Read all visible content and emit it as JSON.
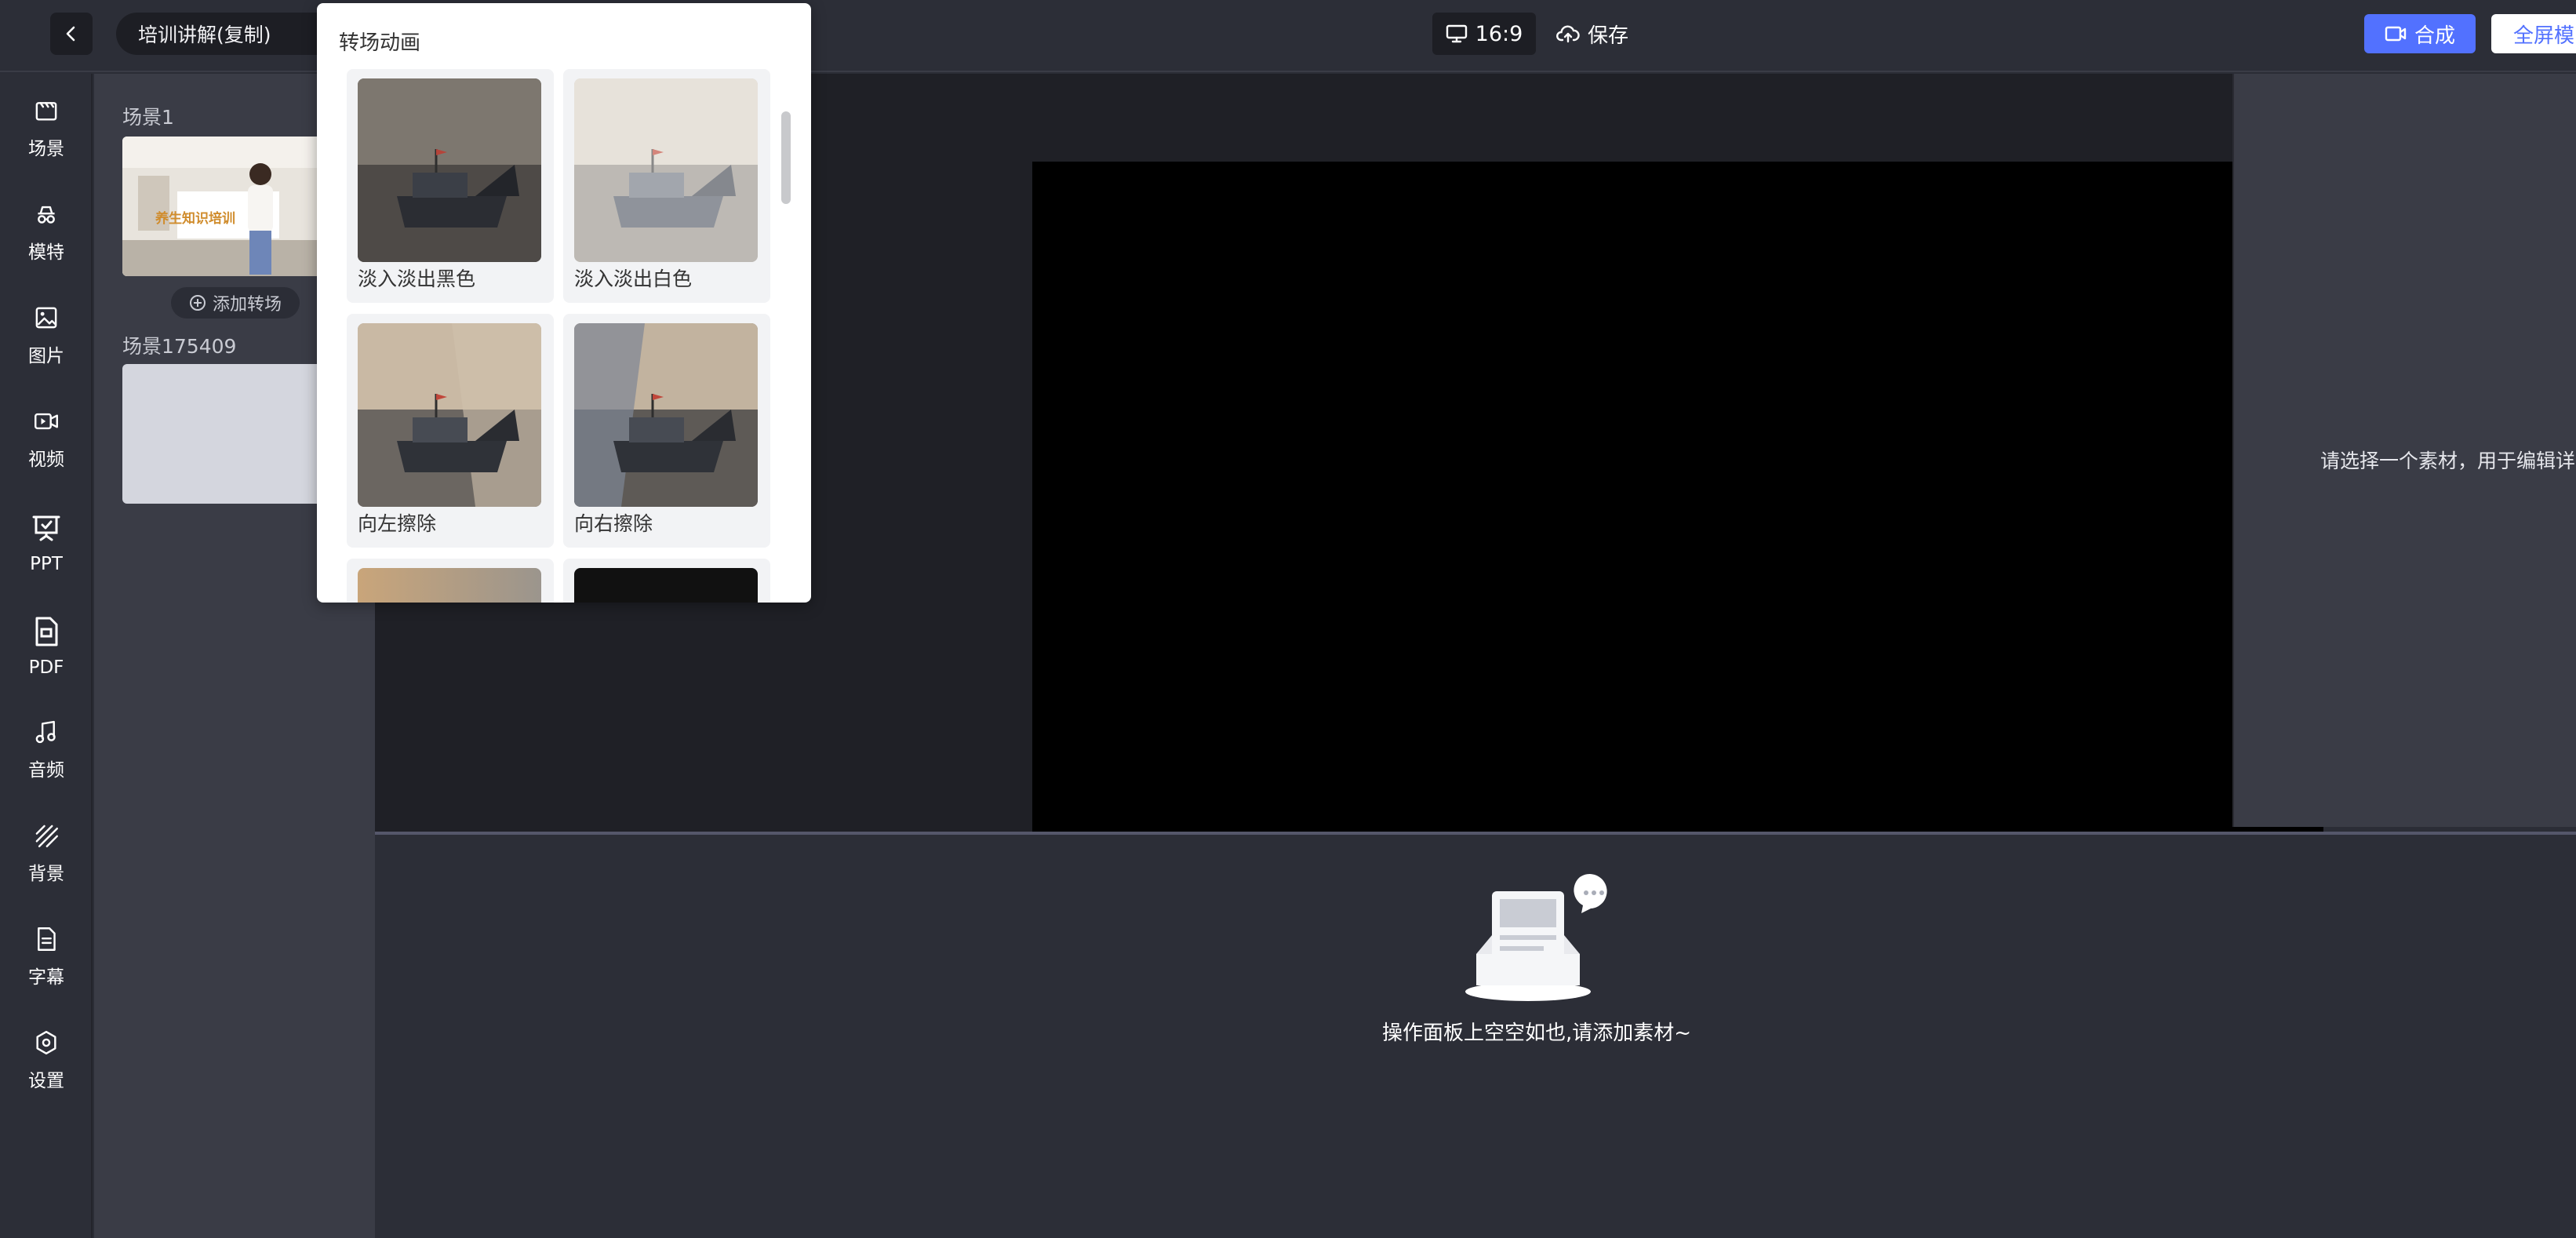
{
  "topbar": {
    "project_title": "培训讲解(复制)",
    "aspect_ratio": "16:9",
    "save_label": "保存",
    "compose_label": "合成",
    "fullscreen_label": "全屏模"
  },
  "sidebar": {
    "items": [
      {
        "label": "场景",
        "icon": "scene-icon"
      },
      {
        "label": "模特",
        "icon": "model-icon"
      },
      {
        "label": "图片",
        "icon": "image-icon"
      },
      {
        "label": "视频",
        "icon": "video-icon"
      },
      {
        "label": "PPT",
        "icon": "ppt-icon"
      },
      {
        "label": "PDF",
        "icon": "pdf-icon"
      },
      {
        "label": "音频",
        "icon": "music-icon"
      },
      {
        "label": "背景",
        "icon": "background-icon"
      },
      {
        "label": "字幕",
        "icon": "subtitle-icon"
      },
      {
        "label": "设置",
        "icon": "settings-icon"
      }
    ]
  },
  "scenes": {
    "items": [
      {
        "name": "场景1",
        "thumbnail_text": "养生知识培训"
      },
      {
        "name": "场景175409"
      }
    ],
    "add_transition_label": "添加转场"
  },
  "transition_popup": {
    "title": "转场动画",
    "items": [
      {
        "label": "淡入淡出黑色"
      },
      {
        "label": "淡入淡出白色"
      },
      {
        "label": "向左擦除"
      },
      {
        "label": "向右擦除"
      }
    ]
  },
  "properties": {
    "hint": "请选择一个素材，用于编辑详"
  },
  "operations": {
    "empty_text": "操作面板上空空如也,请添加素材~"
  },
  "colors": {
    "accent": "#5271ff",
    "canvas": "#000000",
    "panel": "#3a3c46"
  }
}
